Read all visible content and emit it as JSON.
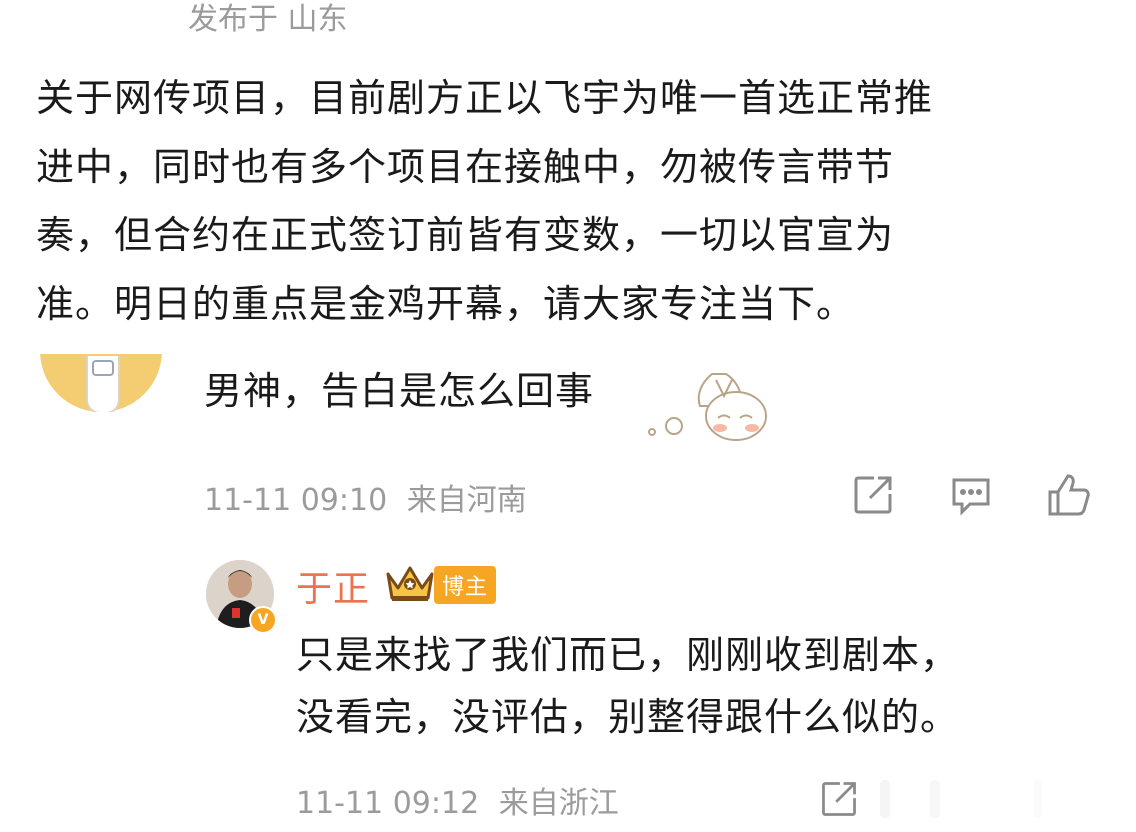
{
  "post": {
    "published_from": "发布于 山东",
    "body_lines": [
      "关于网传项目，目前剧方正以飞宇为唯一首选正常推",
      "进中，同时也有多个项目在接触中，勿被传言带节",
      "奏，但合约在正式签订前皆有变数，一切以官宣为",
      "准。明日的重点是金鸡开幕，请大家专注当下。"
    ]
  },
  "comment": {
    "text": "男神，告白是怎么回事",
    "sticker": "shy-sticker",
    "time": "11-11 09:10",
    "location": "来自河南",
    "actions": [
      "share-icon",
      "comment-icon",
      "like-icon"
    ]
  },
  "reply": {
    "author": "于正",
    "badge_label": "博主",
    "verified_icon": "verified-v-icon",
    "lines": [
      "只是来找了我们而已，刚刚收到剧本，",
      "没看完，没评估，别整得跟什么似的。"
    ],
    "time": "11-11 09:12",
    "location": "来自浙江",
    "actions": [
      "share-icon"
    ]
  },
  "colors": {
    "name": "#eb7350",
    "badge": "#f6a623",
    "meta": "#9b9b9b",
    "text": "#1a1a1a"
  }
}
